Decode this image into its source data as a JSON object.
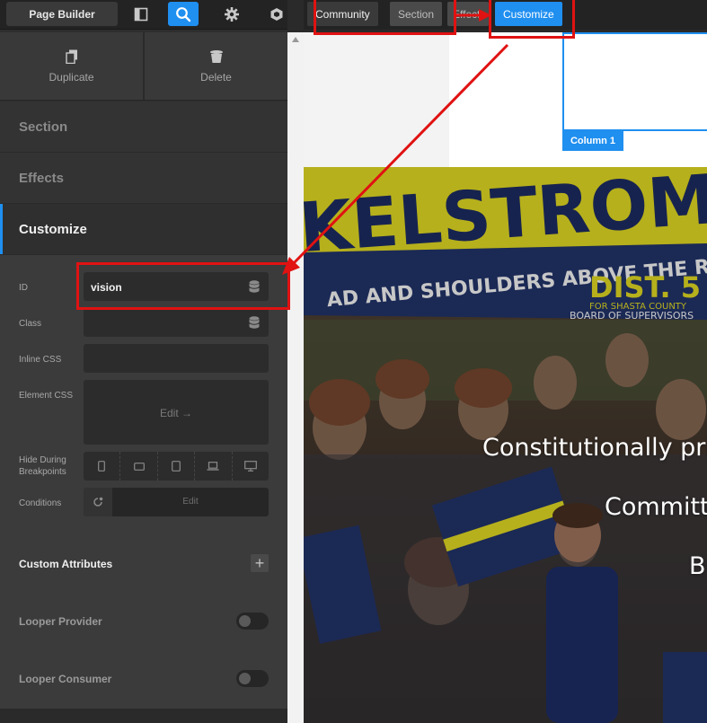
{
  "toolbar": {
    "page_builder_label": "Page Builder",
    "icons": [
      "layout-icon",
      "search-icon",
      "gear-icon",
      "cube-icon"
    ]
  },
  "actions": {
    "duplicate_label": "Duplicate",
    "delete_label": "Delete"
  },
  "nav": {
    "section_label": "Section",
    "effects_label": "Effects",
    "customize_label": "Customize"
  },
  "customize": {
    "id_label": "ID",
    "id_value": "vision",
    "class_label": "Class",
    "class_value": "",
    "inline_css_label": "Inline CSS",
    "element_css_label": "Element CSS",
    "element_css_edit": "Edit →",
    "hide_label_1": "Hide During",
    "hide_label_2": "Breakpoints",
    "conditions_label": "Conditions",
    "conditions_edit": "Edit",
    "custom_attributes_label": "Custom Attributes",
    "looper_provider_label": "Looper Provider",
    "looper_consumer_label": "Looper Consumer"
  },
  "breadcrumbs": {
    "community": "Community",
    "section": "Section",
    "effects": "Effects",
    "customize": "Customize"
  },
  "preview": {
    "column_label": "Column 1",
    "line_1": "Constitutionally pri",
    "line_2": "Committ",
    "line_3": "B"
  },
  "photo_text": {
    "banner_name": "KELSTROM",
    "banner_slogan": "AD AND SHOULDERS ABOVE THE REST!",
    "district": "DIST. 5",
    "county": "FOR SHASTA COUNTY",
    "board": "BOARD OF SUPERVISORS"
  },
  "colors": {
    "accent": "#1f8ff0",
    "highlight": "#e01212",
    "panel_bg": "#2e2e2e"
  }
}
